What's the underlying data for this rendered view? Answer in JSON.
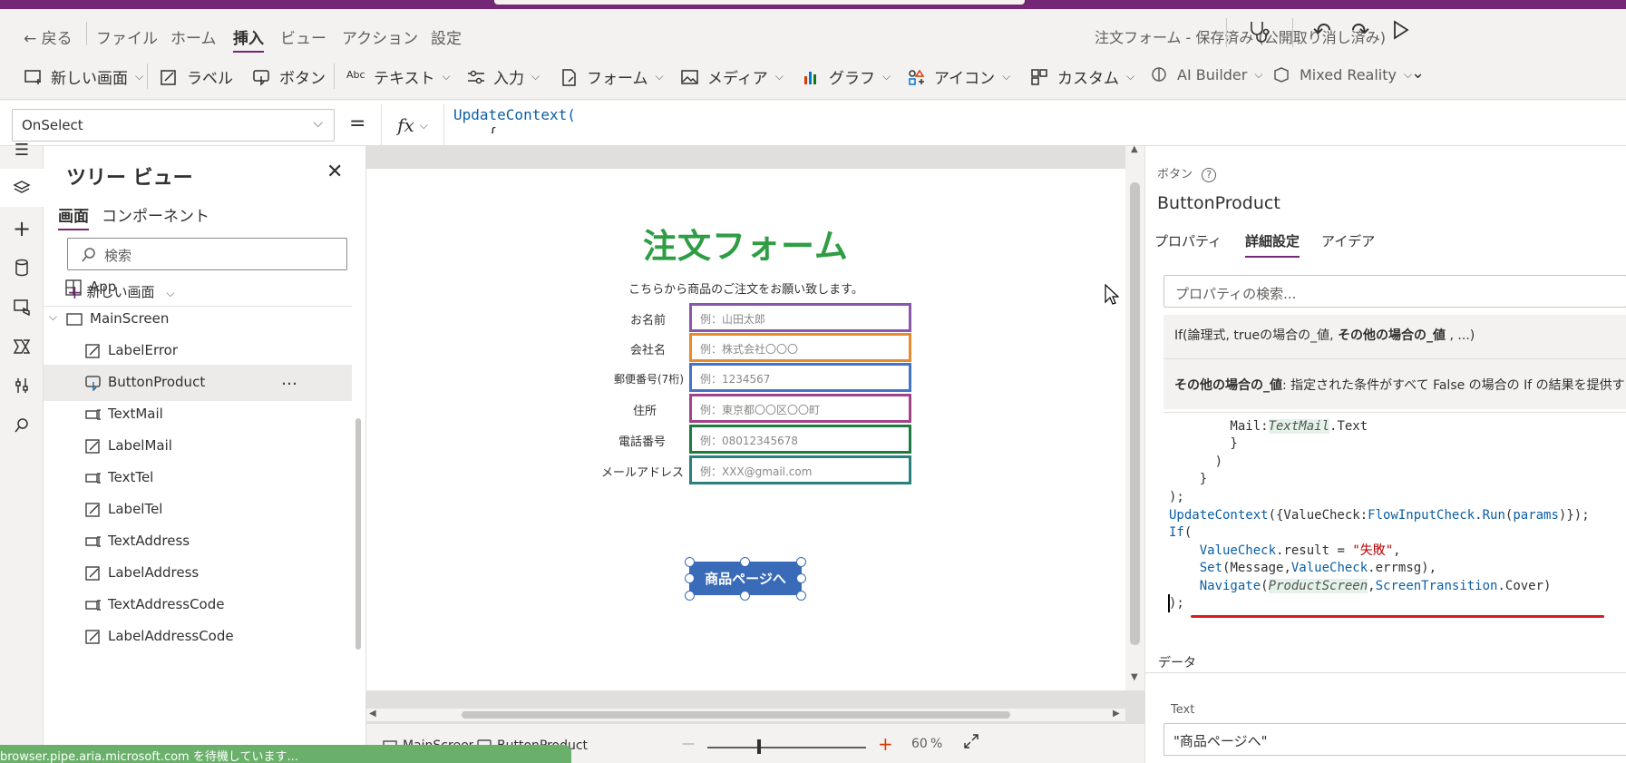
{
  "menubar": {
    "back": "戻る",
    "items": [
      "ファイル",
      "ホーム",
      "挿入",
      "ビュー",
      "アクション",
      "設定"
    ],
    "active": "挿入",
    "doc_status": "注文フォーム - 保存済み (公開取り消し済み)"
  },
  "ribbon": {
    "items": [
      "新しい画面",
      "ラベル",
      "ボタン",
      "テキスト",
      "入力",
      "フォーム",
      "メディア",
      "グラフ",
      "アイコン",
      "カスタム",
      "AI Builder",
      "Mixed Reality"
    ]
  },
  "formula_bar": {
    "property": "OnSelect",
    "equals": "=",
    "fx": "fx",
    "line1": "UpdateContext(",
    "line2": "    {"
  },
  "tree": {
    "title": "ツリー ビュー",
    "tabs": [
      "画面",
      "コンポーネント"
    ],
    "search_placeholder": "検索",
    "new_screen": "新しい画面",
    "items": [
      {
        "label": "App",
        "icon": "app-icon",
        "level": 0
      },
      {
        "label": "MainScreen",
        "icon": "screen-icon",
        "level": 0
      },
      {
        "label": "LabelError",
        "icon": "label-icon",
        "level": 1
      },
      {
        "label": "ButtonProduct",
        "icon": "button-icon",
        "level": 1,
        "selected": true
      },
      {
        "label": "TextMail",
        "icon": "textinput-icon",
        "level": 1
      },
      {
        "label": "LabelMail",
        "icon": "label-icon",
        "level": 1
      },
      {
        "label": "TextTel",
        "icon": "textinput-icon",
        "level": 1
      },
      {
        "label": "LabelTel",
        "icon": "label-icon",
        "level": 1
      },
      {
        "label": "TextAddress",
        "icon": "textinput-icon",
        "level": 1
      },
      {
        "label": "LabelAddress",
        "icon": "label-icon",
        "level": 1
      },
      {
        "label": "TextAddressCode",
        "icon": "textinput-icon",
        "level": 1
      },
      {
        "label": "LabelAddressCode",
        "icon": "label-icon",
        "level": 1
      }
    ],
    "more": "…"
  },
  "canvas": {
    "title": "注文フォーム",
    "subtitle": "こちらから商品のご注文をお願い致します。",
    "fields": [
      {
        "label": "お名前",
        "placeholder": "例：山田太郎",
        "color": "#8a56ac"
      },
      {
        "label": "会社名",
        "placeholder": "例：株式会社〇〇〇",
        "color": "#e8892b"
      },
      {
        "label": "郵便番号(7桁)",
        "placeholder": "例：1234567",
        "color": "#4472c4"
      },
      {
        "label": "住所",
        "placeholder": "例：東京都〇〇区〇〇町",
        "color": "#a0438a"
      },
      {
        "label": "電話番号",
        "placeholder": "例：08012345678",
        "color": "#1e7b3f"
      },
      {
        "label": "メールアドレス",
        "placeholder": "例：XXX@gmail.com",
        "color": "#2a7f7f"
      }
    ],
    "button_label": "商品ページへ"
  },
  "canvas_footer": {
    "screen": "MainScreen",
    "control": "ButtonProduct",
    "zoom_minus": "—",
    "zoom_plus": "+",
    "zoom_value": "60",
    "zoom_unit": "%",
    "zoom_level": 0.6
  },
  "right_panel": {
    "type": "ボタン",
    "name": "ButtonProduct",
    "tabs": [
      "プロパティ",
      "詳細設定",
      "アイデア"
    ],
    "active_tab": "詳細設定",
    "search_placeholder": "プロパティの検索...",
    "signature_pre": "If(論理式, trueの場合の_値, ",
    "signature_bold": "その他の場合の_値",
    "signature_post": " , ...)",
    "desc_bold": "その他の場合の_値",
    "desc_text": ": 指定された条件がすべて False の場合の If の結果を提供す",
    "data_section": "データ",
    "text_label": "Text",
    "text_value": "\"商品ページへ\""
  },
  "code": {
    "l1a": "        Mail:",
    "l1b": "TextMail",
    "l1c": ".Text",
    "l2": "        }",
    "l3": "      )",
    "l4": "    }",
    "l5": ");",
    "l6a": "UpdateContext",
    "l6b": "({ValueCheck:",
    "l6c": "FlowInputCheck",
    "l6d": ".",
    "l6e": "Run",
    "l6f": "(",
    "l6g": "params",
    "l6h": ")});",
    "l7a": "If",
    "l7b": "(",
    "l8a": "    ValueCheck",
    "l8b": ".result = ",
    "l8c": "\"失敗\"",
    "l8d": ",",
    "l9a": "    Set",
    "l9b": "(Message,",
    "l9c": "ValueCheck",
    "l9d": ".errmsg),",
    "l10a": "    Navigate",
    "l10b": "(",
    "l10c": "ProductScreen",
    "l10d": ",",
    "l10e": "ScreenTransition",
    "l10f": ".Cover)",
    "l11": ");"
  },
  "status": {
    "text": "browser.pipe.aria.microsoft.com を待機しています..."
  },
  "colors": {
    "accent": "#742774",
    "form_title": "#2e9d43",
    "button": "#3a6bb8",
    "underline": "#d91b1b"
  }
}
